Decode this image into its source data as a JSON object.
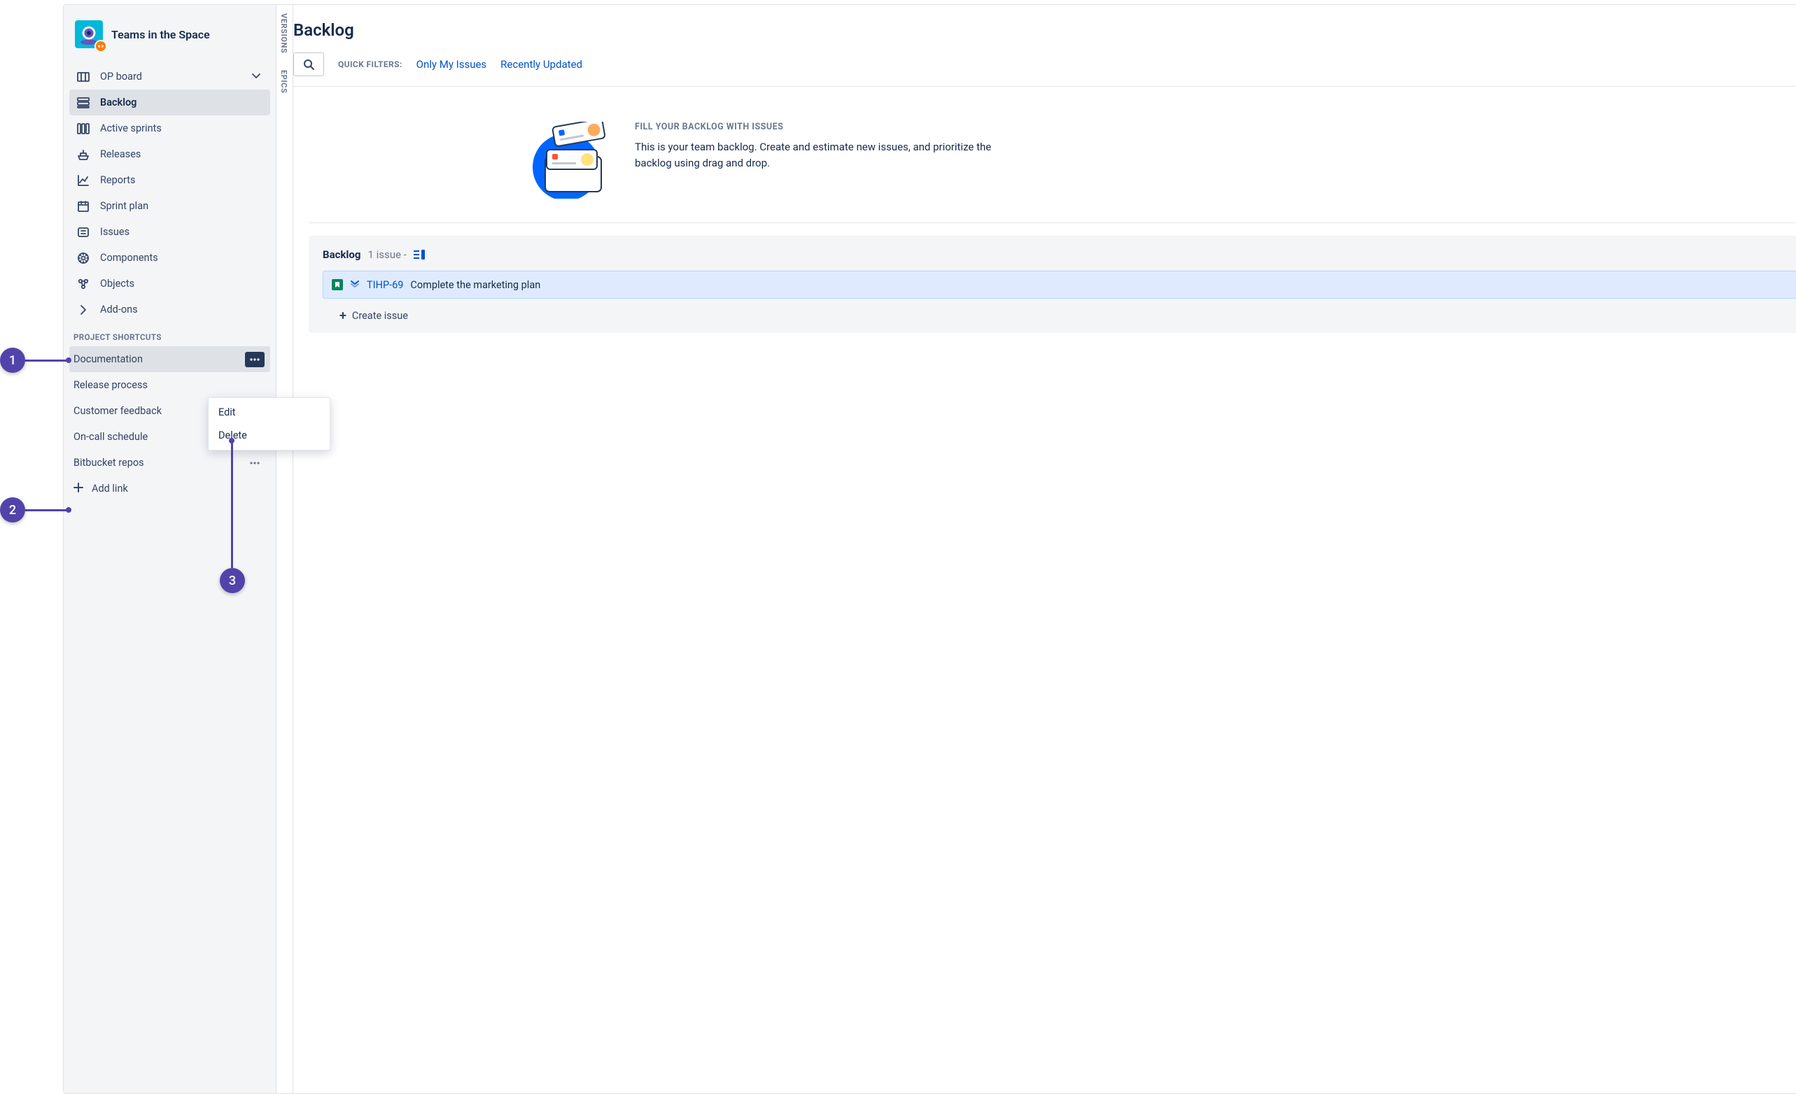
{
  "project": {
    "name": "Teams in the Space"
  },
  "sidebar": {
    "nav": [
      {
        "id": "op-board",
        "label": "OP board",
        "icon": "board",
        "chevron": true
      },
      {
        "id": "backlog",
        "label": "Backlog",
        "icon": "backlog",
        "selected": true
      },
      {
        "id": "sprints",
        "label": "Active sprints",
        "icon": "columns"
      },
      {
        "id": "releases",
        "label": "Releases",
        "icon": "ship"
      },
      {
        "id": "reports",
        "label": "Reports",
        "icon": "chart"
      },
      {
        "id": "sprintplan",
        "label": "Sprint plan",
        "icon": "calendar"
      },
      {
        "id": "issues",
        "label": "Issues",
        "icon": "issues"
      },
      {
        "id": "components",
        "label": "Components",
        "icon": "component"
      },
      {
        "id": "objects",
        "label": "Objects",
        "icon": "objects"
      },
      {
        "id": "addons",
        "label": "Add-ons",
        "icon": "chevron-right"
      }
    ],
    "shortcuts_heading": "PROJECT SHORTCUTS",
    "shortcuts": [
      {
        "label": "Documentation",
        "hovered": true,
        "menuOpen": true
      },
      {
        "label": "Release process",
        "hovered": false
      },
      {
        "label": "Customer feedback",
        "hovered": false
      },
      {
        "label": "On-call schedule",
        "hovered": false,
        "showDots": true
      },
      {
        "label": "Bitbucket repos",
        "hovered": false,
        "showDots": true
      }
    ],
    "add_link_label": "Add link",
    "context_menu": {
      "items": [
        "Edit",
        "Delete"
      ]
    }
  },
  "rails": {
    "versions": "VERSIONS",
    "epics": "EPICS"
  },
  "page": {
    "title": "Backlog",
    "quick_filters_label": "QUICK FILTERS:",
    "filters": [
      "Only My Issues",
      "Recently Updated"
    ],
    "empty": {
      "heading": "FILL YOUR BACKLOG WITH ISSUES",
      "body": "This is your team backlog. Create and estimate new issues, and prioritize the backlog using drag and drop."
    },
    "backlog": {
      "title": "Backlog",
      "count_label": "1 issue -",
      "issues": [
        {
          "key": "TIHP-69",
          "summary": "Complete the marketing plan"
        }
      ],
      "create_label": "Create issue"
    }
  },
  "callouts": {
    "c1": "1",
    "c2": "2",
    "c3": "3"
  }
}
